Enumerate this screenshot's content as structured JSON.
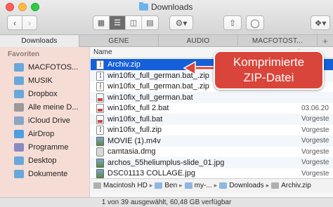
{
  "window": {
    "title": "Downloads"
  },
  "toolbar": {
    "back_icon": "chevron-left-icon",
    "forward_icon": "chevron-right-icon",
    "view_modes": [
      "icon-view-icon",
      "list-view-icon",
      "column-view-icon",
      "coverflow-view-icon"
    ],
    "active_view": "list-view-icon"
  },
  "tabs": [
    {
      "label": "Downloads",
      "active": true
    },
    {
      "label": "GENE",
      "active": false
    },
    {
      "label": "AUDIO",
      "active": false
    },
    {
      "label": "MACFOTOST...",
      "active": false
    }
  ],
  "sidebar": {
    "heading": "Favoriten",
    "items": [
      {
        "label": "MACFOTOS...",
        "icon": "folder-icon",
        "color": "#6aa7dc"
      },
      {
        "label": "MUSIK",
        "icon": "folder-icon",
        "color": "#6aa7dc"
      },
      {
        "label": "Dropbox",
        "icon": "folder-icon",
        "color": "#6aa7dc"
      },
      {
        "label": "Alle meine D...",
        "icon": "all-files-icon",
        "color": "#9a9a9a"
      },
      {
        "label": "iCloud Drive",
        "icon": "cloud-icon",
        "color": "#8aa6c4"
      },
      {
        "label": "AirDrop",
        "icon": "airdrop-icon",
        "color": "#4f9fe0"
      },
      {
        "label": "Programme",
        "icon": "applications-icon",
        "color": "#8a8ac4"
      },
      {
        "label": "Desktop",
        "icon": "desktop-icon",
        "color": "#6aa7dc"
      },
      {
        "label": "Dokumente",
        "icon": "documents-icon",
        "color": "#6aa7dc"
      }
    ]
  },
  "list": {
    "col_name": "Name",
    "col_date": "",
    "rows": [
      {
        "name": "Archiv.zip",
        "date": "",
        "type": "zip",
        "selected": true
      },
      {
        "name": "win10fix_full_german.bat_.zip",
        "date": "",
        "type": "zip"
      },
      {
        "name": "win10fix_full_german.bat_.zip",
        "date": "",
        "type": "zip"
      },
      {
        "name": "win10fix_full_german.bat",
        "date": "",
        "type": "bat"
      },
      {
        "name": "win10fix_full 2.bat",
        "date": "03.06.20",
        "type": "bat"
      },
      {
        "name": "win10fix_full.bat",
        "date": "Vorgeste",
        "type": "bat"
      },
      {
        "name": "win10fix_full.zip",
        "date": "Vorgeste",
        "type": "zip"
      },
      {
        "name": "MOVIE (1).m4v",
        "date": "Vorgeste",
        "type": "img"
      },
      {
        "name": "camtasia.dmg",
        "date": "Vorgeste",
        "type": "dmg"
      },
      {
        "name": "archos_55heliumplus-slide_01.jpg",
        "date": "Vorgeste",
        "type": "img"
      },
      {
        "name": "DSC01113 COLLAGE.jpg",
        "date": "Vorgeste",
        "type": "img"
      }
    ]
  },
  "pathbar": {
    "crumbs": [
      "Macintosh HD",
      "Ben",
      "my-...",
      "Downloads",
      "Archiv.zip"
    ]
  },
  "status": {
    "text": "1 von 39 ausgewählt, 60,48 GB verfügbar"
  },
  "callout": {
    "line1": "Komprimierte",
    "line2": "ZIP-Datei",
    "color": "#d9453a"
  }
}
